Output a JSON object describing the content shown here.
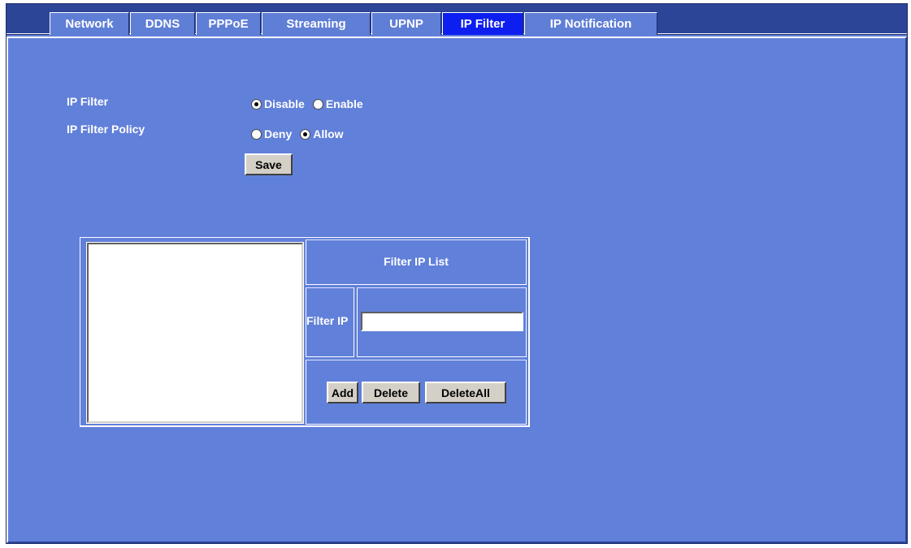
{
  "tabs": [
    {
      "label": "Network",
      "active": false
    },
    {
      "label": "DDNS",
      "active": false
    },
    {
      "label": "PPPoE",
      "active": false
    },
    {
      "label": "Streaming",
      "active": false
    },
    {
      "label": "UPNP",
      "active": false
    },
    {
      "label": "IP Filter",
      "active": true
    },
    {
      "label": "IP Notification",
      "active": false
    }
  ],
  "ip_filter": {
    "label": "IP Filter",
    "options": [
      {
        "label": "Disable",
        "checked": true
      },
      {
        "label": "Enable",
        "checked": false
      }
    ]
  },
  "ip_filter_policy": {
    "label": "IP Filter Policy",
    "options": [
      {
        "label": "Deny",
        "checked": false
      },
      {
        "label": "Allow",
        "checked": true
      }
    ]
  },
  "save_label": "Save",
  "filter_list": {
    "title": "Filter IP List",
    "filter_ip_label": "Filter IP",
    "filter_ip_value": "",
    "add_label": "Add",
    "delete_label": "Delete",
    "delete_all_label": "DeleteAll"
  },
  "colors": {
    "background": "#6180d9",
    "tab_bar": "#2c4597",
    "active_tab": "#0d1ef0",
    "button_face": "#d4d0c8"
  }
}
